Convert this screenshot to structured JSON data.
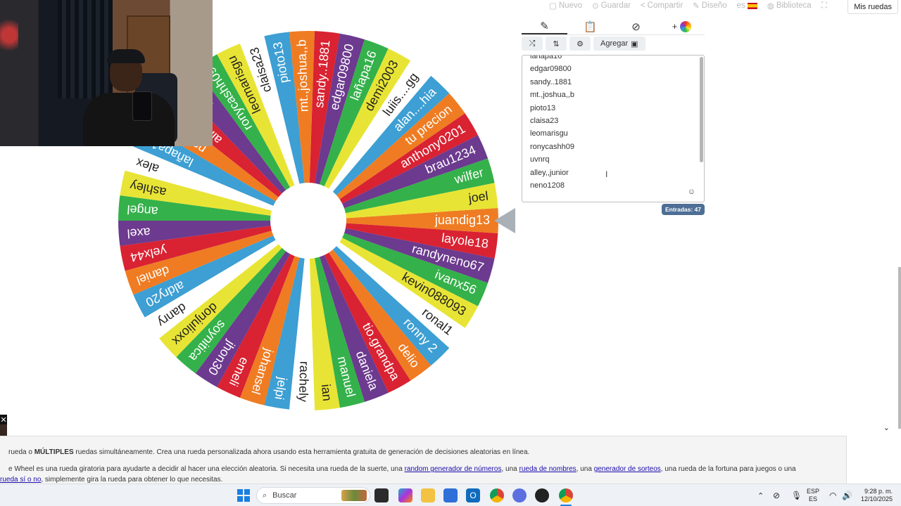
{
  "top_nav": {
    "items": [
      "Nuevo",
      "Guardar",
      "Compartir",
      "Diseño",
      "es",
      "Biblioteca"
    ],
    "mis_ruedas": "Mis ruedas"
  },
  "colors": {
    "segments": [
      "#ef7c22",
      "#d92232",
      "#6c3a8e",
      "#34b14a",
      "#e8e435",
      "#ffffff",
      "#3d9fd3"
    ],
    "pointer": "#a9b0b8",
    "badge": "#4e6e95"
  },
  "wheel": {
    "segments": [
      "juandig13",
      "layole18",
      "randyneno67",
      "ivanx56",
      "kevin088093",
      "ronal1",
      "ronny 2",
      "delio",
      "tio.grandpa",
      "daniela",
      "manuel",
      "ian",
      "rachely",
      "jelpi",
      "johansel",
      "emeli",
      "jhon30",
      "soynitica",
      "donjulioxx",
      "danry",
      "aldry20",
      "daniel",
      "yelx44",
      "axel",
      "angel",
      "ashley",
      "alex",
      "lañapa16",
      "neno1208",
      "alley,,junior",
      "uvnrq",
      "ronycashh09",
      "leomarisgu",
      "claisa23",
      "pioto13",
      "mt.,joshua,,b",
      "sandy..1881",
      "edgar09800",
      "lañapa16",
      "demi2003",
      "luiis....gg",
      "alan....hia",
      "tu precion",
      "anthony0201",
      "brau1234",
      "wilfer",
      "joel"
    ]
  },
  "editor": {
    "tabs": [
      "edit",
      "results",
      "hide",
      "add-color"
    ],
    "toolbar": {
      "shuffle": "shuffle",
      "sort": "sort",
      "image_settings": "image settings",
      "add_label": "Agregar"
    },
    "entries_visible": [
      "lañapa16",
      "edgar09800",
      "sandy..1881",
      "mt.,joshua,,b",
      "pioto13",
      "claisa23",
      "leomarisgu",
      "ronycashh09",
      "uvnrq",
      "alley,,junior",
      "neno1208"
    ],
    "count_label": "Entradas: 47"
  },
  "footer": {
    "line1_a": "rueda o ",
    "line1_bold": "MÚLTIPLES",
    "line1_b": " ruedas simultáneamente. Crea una rueda personalizada ahora usando esta herramienta gratuita de generación de decisiones aleatorias en línea.",
    "line2_a": "e Wheel es una rueda giratoria para ayudarte a decidir al hacer una elección aleatoria. Si necesita una rueda de la suerte, una ",
    "link1": "random generador de números",
    "line2_b": ", una ",
    "link2": "rueda de nombres",
    "line2_c": ", una ",
    "link3": "generador de sorteos",
    "line2_d": ", una rueda de la fortuna para juegos o una",
    "link4": "rueda sí o no",
    "line3": ", simplemente gira la rueda para obtener lo que necesitas."
  },
  "taskbar": {
    "search_placeholder": "Buscar",
    "lang_top": "ESP",
    "lang_bottom": "ES",
    "time": "9:28 p. m.",
    "date": "12/10/2025"
  }
}
